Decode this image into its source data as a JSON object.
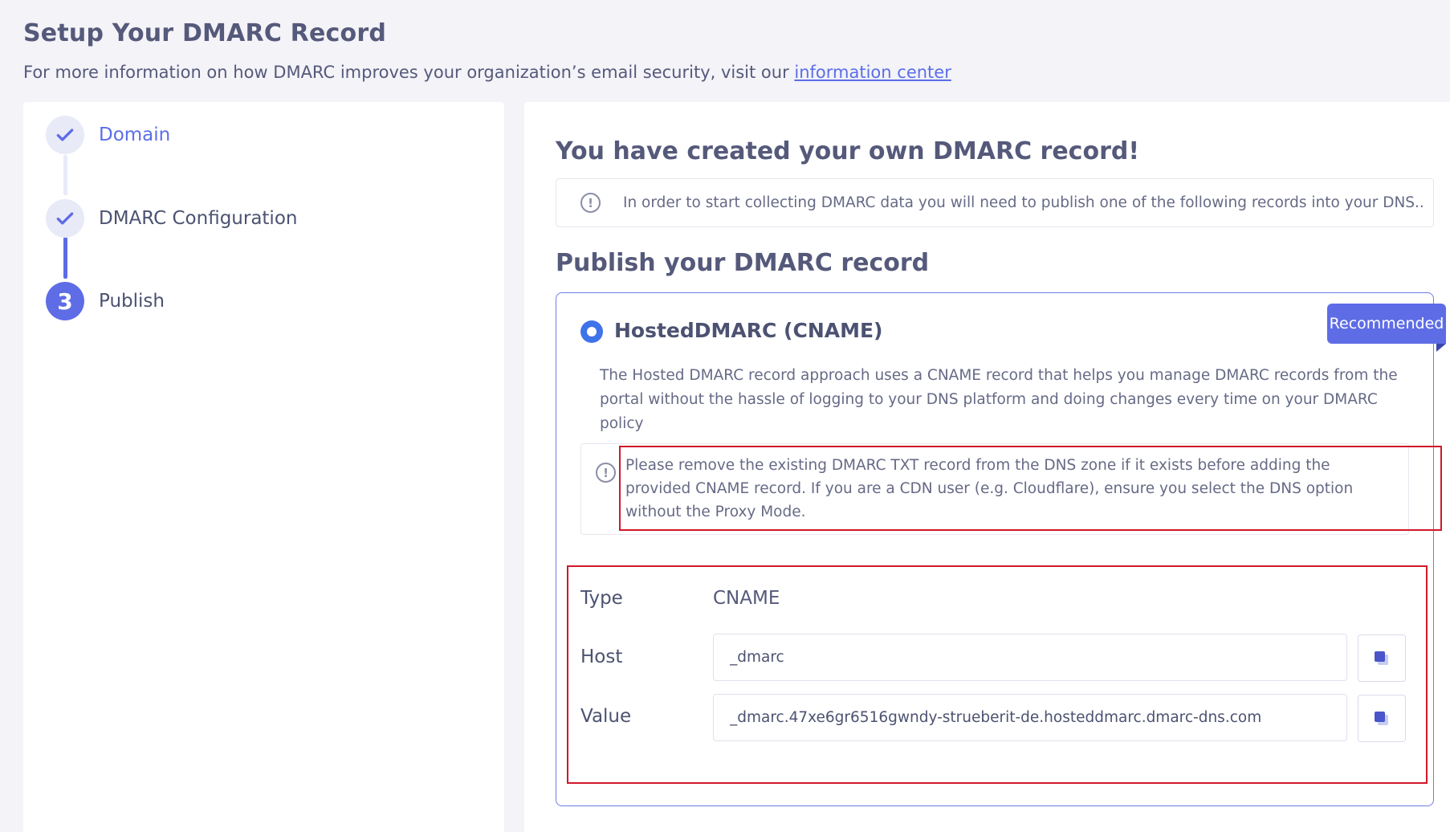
{
  "header": {
    "title": "Setup Your DMARC Record",
    "subtitle": "For more information on how DMARC improves your organization’s email security, visit our ",
    "link_text": "information center"
  },
  "stepper": {
    "steps": [
      {
        "label": "Domain",
        "status": "completed"
      },
      {
        "label": "DMARC Configuration",
        "status": "completed"
      },
      {
        "label": "Publish",
        "number": "3",
        "status": "active"
      }
    ]
  },
  "content": {
    "created_heading": "You have created your own DMARC record!",
    "info_text": "In order to start collecting DMARC data you will need to publish one of the following records into your DNS..",
    "publish_heading": "Publish your DMARC record",
    "option": {
      "title": "HostedDMARC (CNAME)",
      "selected": true,
      "badge": "Recommended",
      "description": "The Hosted DMARC record approach uses a CNAME record that helps you manage DMARC records from the portal without the hassle of logging to your DNS platform and doing changes every time on your DMARC policy",
      "warning": "Please remove the existing DMARC TXT record from the DNS zone if it exists before adding the provided CNAME record. If you are a CDN user (e.g. Cloudflare), ensure you select the DNS option without the Proxy Mode."
    },
    "record": {
      "type_label": "Type",
      "type_value": "CNAME",
      "host_label": "Host",
      "host_value": "_dmarc",
      "value_label": "Value",
      "value_value": "_dmarc.47xe6gr6516gwndy-strueberit-de.hosteddmarc.dmarc-dns.com"
    }
  },
  "colors": {
    "accent": "#5e6ce6",
    "radio": "#3f73ea",
    "highlight_outline": "#d0182a"
  },
  "icons": {
    "completed_step": "checkmark-icon",
    "info": "exclamation-circle-icon",
    "copy": "copy-icon"
  }
}
